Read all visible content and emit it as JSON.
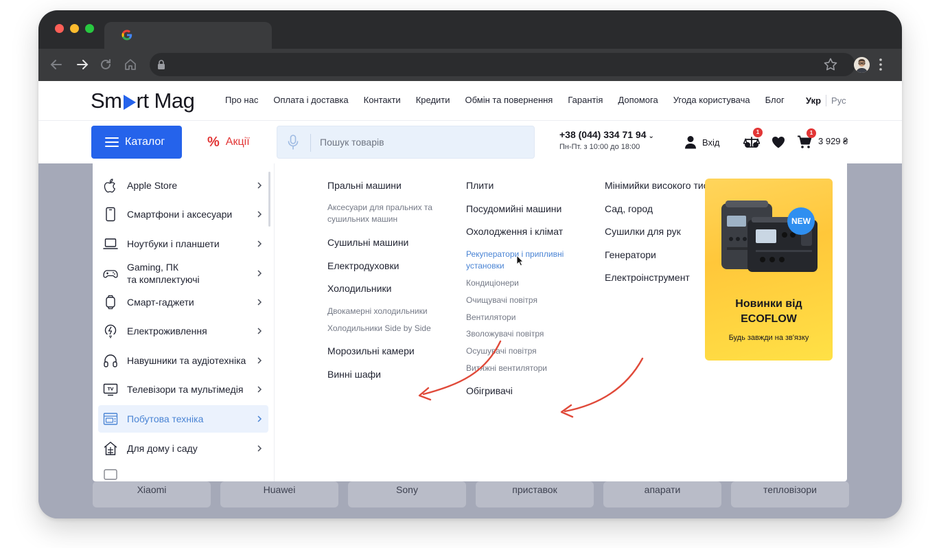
{
  "site": {
    "logo_prefix": "Sm",
    "logo_suffix": "rt Mag",
    "top_nav": [
      "Про нас",
      "Оплата і доставка",
      "Контакти",
      "Кредити",
      "Обмін та повернення",
      "Гарантія",
      "Допомога",
      "Угода користувача",
      "Блог"
    ],
    "lang_active": "Укр",
    "lang_other": "Рус"
  },
  "header": {
    "catalog_label": "Каталог",
    "promo_symbol": "%",
    "promo_label": "Акції",
    "search_placeholder": "Пошук товарів",
    "phone": "+38 (044) 334 71 94",
    "phone_chevron": "⌄",
    "hours": "Пн-Пт. з 10:00 до 18:00",
    "login_label": "Вхід",
    "compare_count": "1",
    "cart_count": "1",
    "cart_total": "3 929 ₴"
  },
  "categories": [
    {
      "label": "Apple Store",
      "icon": "apple-icon"
    },
    {
      "label": "Смартфони і аксесуари",
      "icon": "smartphone-icon"
    },
    {
      "label": "Ноутбуки і планшети",
      "icon": "laptop-icon"
    },
    {
      "label": "Gaming, ПК",
      "label2": "та комплектуючі",
      "icon": "gamepad-icon"
    },
    {
      "label": "Смарт-гаджети",
      "icon": "smartwatch-icon"
    },
    {
      "label": "Електроживлення",
      "icon": "power-icon"
    },
    {
      "label": "Навушники та аудіотехніка",
      "icon": "headphones-icon"
    },
    {
      "label": "Телевізори та мультімедія",
      "icon": "tv-icon"
    },
    {
      "label": "Побутова техніка",
      "icon": "appliance-icon",
      "active": true
    },
    {
      "label": "Для дому і саду",
      "icon": "home-garden-icon"
    }
  ],
  "subcategories": {
    "col1": [
      "Пральні машини",
      "Аксесуари для пральних та сушильних машин",
      "Сушильні машини",
      "Електродуховки",
      "Холодильники",
      "Двокамерні холодильники",
      "Холодильники Side by Side",
      "Морозильні камери",
      "Винні шафи"
    ],
    "col2": [
      "Плити",
      "Посудомийні машини",
      "Охолодження і клімат",
      "Рекуператори і припливні установки",
      "Кондиціонери",
      "Очищувачі повітря",
      "Вентилятори",
      "Зволожувачі повітря",
      "Осушувачі повітря",
      "Витяжні вентилятори",
      "Обігривачі"
    ],
    "col3": [
      "Мінімийки високого тиску",
      "Сад, город",
      "Сушилки для рук",
      "Генератори",
      "Електроінструмент"
    ]
  },
  "banner": {
    "badge": "NEW",
    "title_line1": "Новинки від",
    "title_line2": "ECOFLOW",
    "subtitle": "Будь завжди на зв'язку",
    "product_label": "ECOFLOW"
  },
  "behind": [
    "Xiaomi",
    "Huawei",
    "Sony",
    "приставок",
    "апарати",
    "тепловізори"
  ],
  "colors": {
    "accent": "#2563eb",
    "promo": "#e23636",
    "highlight": "#4a84d4",
    "arrow": "#e04a3a"
  }
}
